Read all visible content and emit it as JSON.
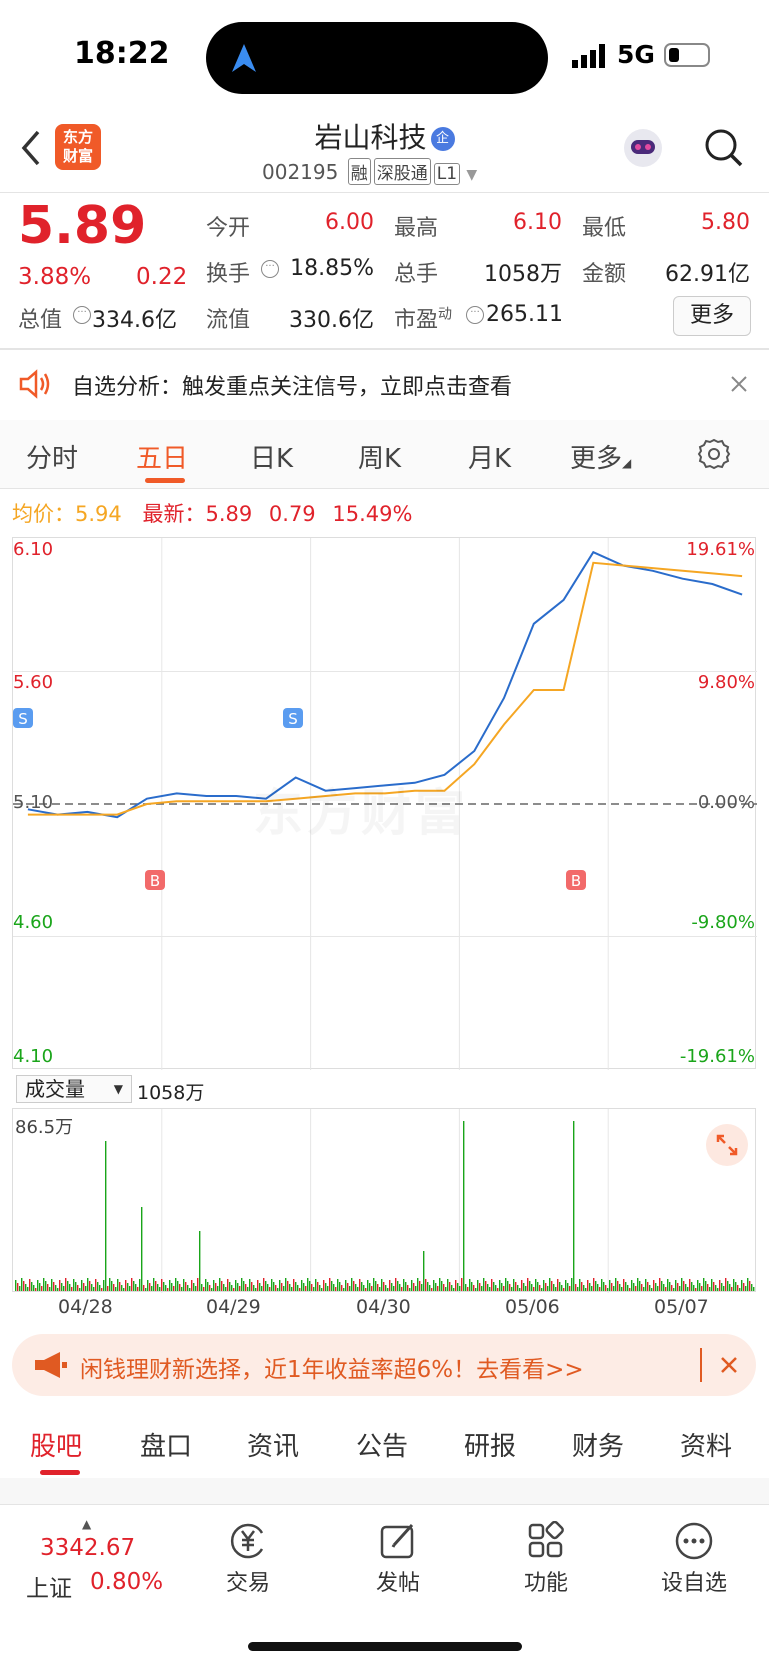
{
  "status": {
    "time": "18:22",
    "network": "5G"
  },
  "header": {
    "logo_line1": "东方",
    "logo_line2": "财富",
    "stock_name": "岩山科技",
    "badge": "企",
    "code": "002195",
    "tags": [
      "融",
      "深股通",
      "L1"
    ]
  },
  "quote": {
    "price": "5.89",
    "change_pct": "3.88%",
    "change": "0.22",
    "open_label": "今开",
    "open": "6.00",
    "high_label": "最高",
    "high": "6.10",
    "low_label": "最低",
    "low": "5.80",
    "turnover_label": "换手",
    "turnover": "18.85%",
    "volume_label": "总手",
    "volume": "1058万",
    "amount_label": "金额",
    "amount": "62.91亿",
    "mktcap_label": "总值",
    "mktcap": "334.6亿",
    "float_label": "流值",
    "float": "330.6亿",
    "pe_label": "市盈",
    "pe_sup": "动",
    "pe": "265.11",
    "more": "更多"
  },
  "notice": {
    "text": "自选分析：触发重点关注信号，立即点击查看"
  },
  "tabs": [
    "分时",
    "五日",
    "日K",
    "周K",
    "月K",
    "更多",
    "settings"
  ],
  "active_tab": "五日",
  "info": {
    "avg_label": "均价：",
    "avg": "5.94",
    "latest_label": "最新：",
    "latest": "5.89",
    "chg": "0.79",
    "pct": "15.49%"
  },
  "chart_data": {
    "type": "line",
    "y_left_ticks": [
      "6.10",
      "5.60",
      "5.10",
      "4.60",
      "4.10"
    ],
    "y_right_ticks": [
      "19.61%",
      "9.80%",
      "0.00%",
      "-9.80%",
      "-19.61%"
    ],
    "x": [
      "04/28",
      "04/29",
      "04/30",
      "05/06",
      "05/07"
    ],
    "prev_close": 5.1,
    "series": [
      {
        "values": [
          5.08,
          5.06,
          5.07,
          5.05,
          5.12,
          5.14,
          5.13,
          5.13,
          5.12,
          5.2,
          5.15,
          5.16,
          5.17,
          5.18,
          5.21,
          5.3,
          5.5,
          5.78,
          5.87,
          6.05,
          6.0,
          5.98,
          5.95,
          5.93,
          5.89
        ]
      },
      {
        "values": [
          5.06,
          5.06,
          5.06,
          5.06,
          5.1,
          5.11,
          5.11,
          5.11,
          5.11,
          5.12,
          5.13,
          5.14,
          5.14,
          5.15,
          5.15,
          5.25,
          5.4,
          5.53,
          5.53,
          6.01,
          6.0,
          5.99,
          5.98,
          5.97,
          5.96
        ]
      }
    ],
    "markers": [
      {
        "type": "S",
        "day": "04/28"
      },
      {
        "type": "B",
        "day": "04/28"
      },
      {
        "type": "S",
        "day": "04/30"
      },
      {
        "type": "B",
        "day": "05/07"
      }
    ]
  },
  "volume": {
    "label": "成交量",
    "value": "1058万",
    "max": "86.5万"
  },
  "banner": {
    "text": "闲钱理财新选择，近1年收益率超6%！去看看>>"
  },
  "bottom_tabs": [
    "股吧",
    "盘口",
    "资讯",
    "公告",
    "研报",
    "财务",
    "资料"
  ],
  "nav": {
    "index_value": "3342.67",
    "index_name": "上证",
    "index_pct": "0.80%",
    "items": [
      "交易",
      "发帖",
      "功能",
      "设自选"
    ]
  },
  "colors": {
    "red": "#e0222b",
    "green": "#1aa51a",
    "blue": "#2a6ccb",
    "orange": "#f5a623",
    "brand": "#f05a28"
  }
}
